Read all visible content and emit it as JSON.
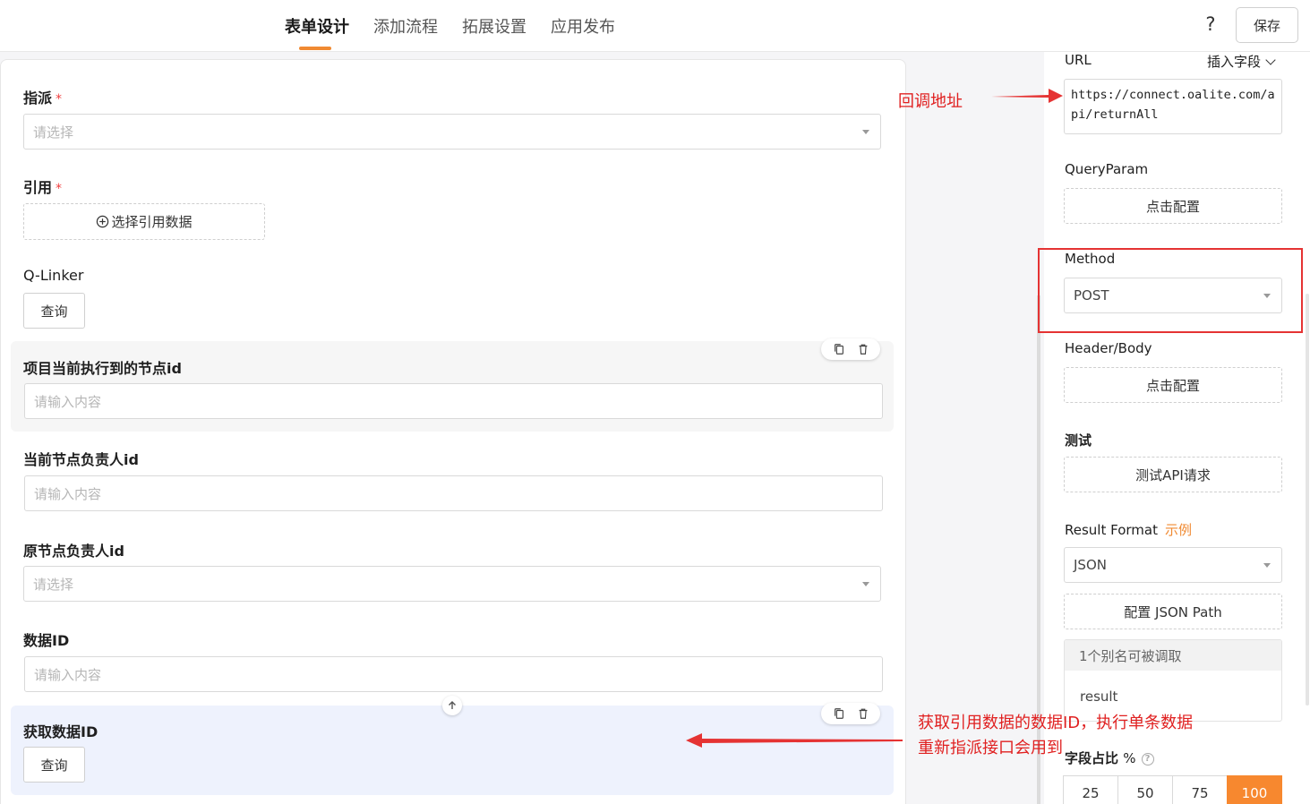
{
  "header": {
    "tabs": [
      {
        "label": "表单设计",
        "active": true
      },
      {
        "label": "添加流程",
        "active": false
      },
      {
        "label": "拓展设置",
        "active": false
      },
      {
        "label": "应用发布",
        "active": false
      }
    ],
    "help_label": "?",
    "save_label": "保存"
  },
  "form": {
    "assign": {
      "label": "指派",
      "required_mark": "*",
      "placeholder": "请选择"
    },
    "reference": {
      "label": "引用",
      "required_mark": "*",
      "button_label": "选择引用数据"
    },
    "qlinker": {
      "label": "Q-Linker",
      "button_label": "查询"
    },
    "current_node": {
      "label": "项目当前执行到的节点id",
      "placeholder": "请输入内容"
    },
    "current_owner": {
      "label": "当前节点负责人id",
      "placeholder": "请输入内容"
    },
    "original_owner": {
      "label": "原节点负责人id",
      "placeholder": "请选择"
    },
    "data_id": {
      "label": "数据ID",
      "placeholder": "请输入内容"
    },
    "get_data_id": {
      "label": "获取数据ID",
      "button_label": "查询"
    }
  },
  "panel": {
    "url_label": "URL",
    "insert_field_label": "插入字段",
    "url_value": "https://connect.oalite.com/api/returnAll",
    "query_param_label": "QueryParam",
    "query_param_button": "点击配置",
    "method_label": "Method",
    "method_value": "POST",
    "header_body_label": "Header/Body",
    "header_body_button": "点击配置",
    "test_label": "测试",
    "test_button": "测试API请求",
    "result_format_label": "Result Format",
    "example_link": "示例",
    "result_format_value": "JSON",
    "json_path_button": "配置 JSON Path",
    "alias_header": "1个别名可被调取",
    "alias_item": "result",
    "width_ratio_label": "字段占比",
    "width_ratio_unit": "%",
    "width_options": [
      "25",
      "50",
      "75",
      "100"
    ],
    "width_selected": "100"
  },
  "annotations": {
    "callback": "回调地址",
    "note_line1": "获取引用数据的数据ID，执行单条数据",
    "note_line2": "重新指派接口会用到"
  },
  "colors": {
    "accent": "#f7882f",
    "annotation_red": "#e02020"
  }
}
